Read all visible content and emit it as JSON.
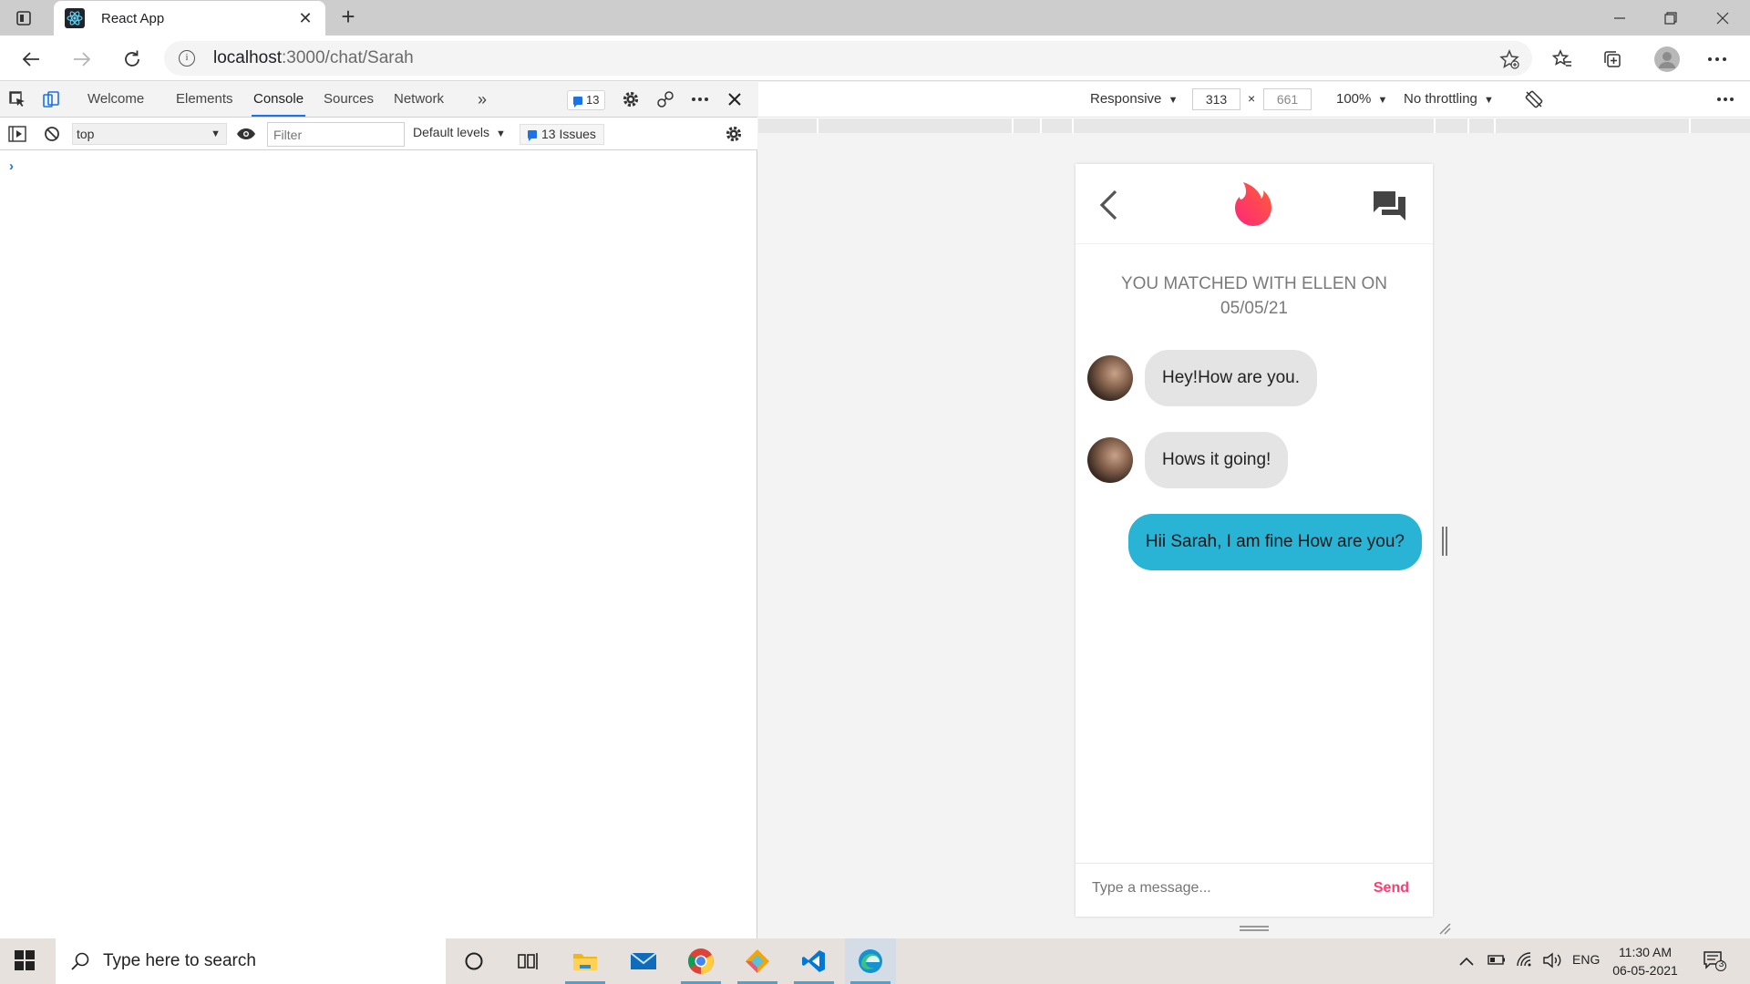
{
  "browser": {
    "tab_title": "React App",
    "url_host": "localhost",
    "url_path": ":3000/chat/Sarah"
  },
  "devtools": {
    "tabs": [
      "Welcome",
      "Elements",
      "Console",
      "Sources",
      "Network"
    ],
    "active_tab": "Console",
    "message_count": "13",
    "console": {
      "context": "top",
      "filter_placeholder": "Filter",
      "levels": "Default levels",
      "issues": "13 Issues"
    }
  },
  "emulation": {
    "device": "Responsive",
    "width": "313",
    "height": "661",
    "zoom": "100%",
    "throttling": "No throttling"
  },
  "app": {
    "matched_text": "YOU MATCHED WITH ELLEN ON 05/05/21",
    "messages": [
      {
        "from": "them",
        "text": "Hey!How are you."
      },
      {
        "from": "them",
        "text": "Hows it going!"
      },
      {
        "from": "me",
        "text": "Hii Sarah, I am fine How are you?"
      }
    ],
    "input_placeholder": "Type a message...",
    "send_label": "Send",
    "brand_color": "#fe3c72",
    "my_bubble_color": "#29b3d4"
  },
  "taskbar": {
    "search_placeholder": "Type here to search",
    "language": "ENG",
    "time": "11:30 AM",
    "date": "06-05-2021",
    "notification_count": "3"
  }
}
